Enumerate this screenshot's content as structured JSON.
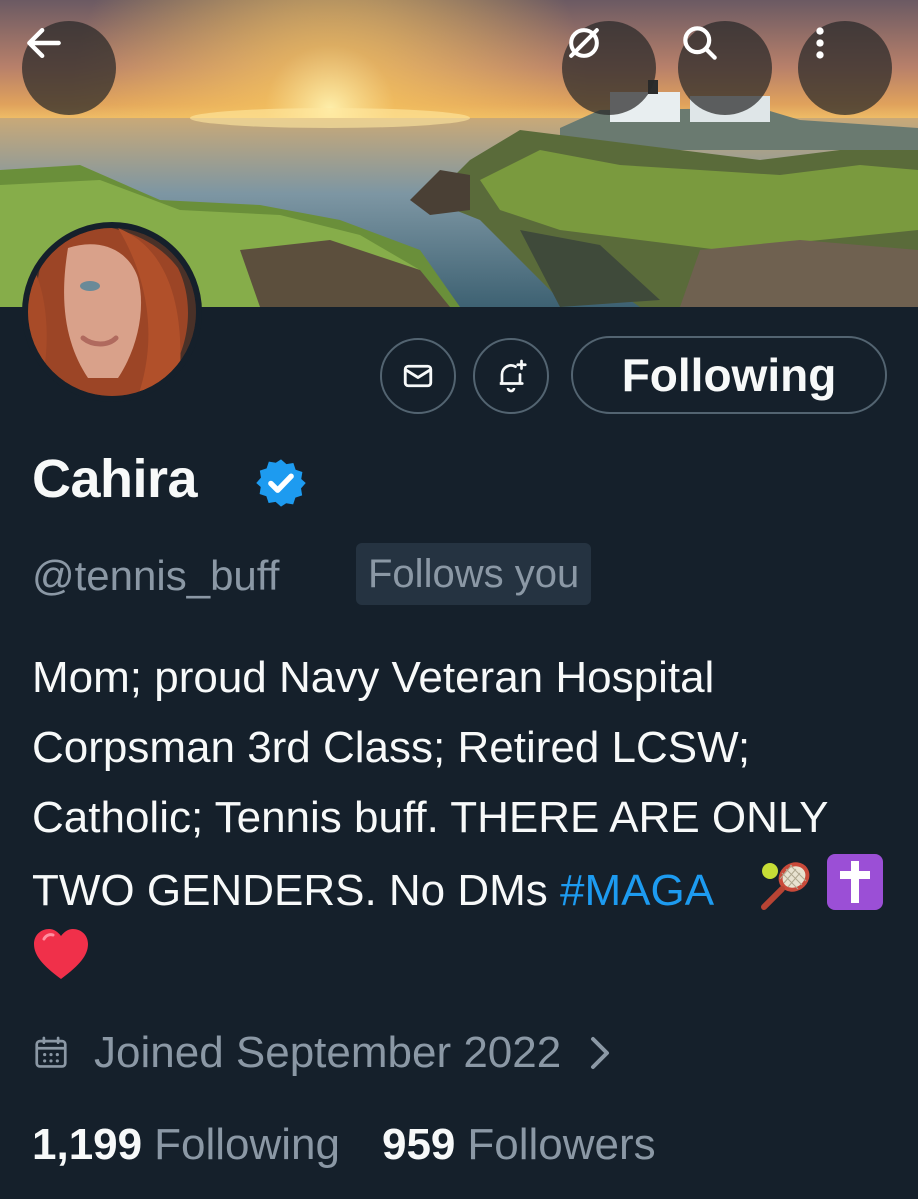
{
  "header": {
    "back_icon": "arrow-left-icon",
    "grok_icon": "slashed-circle-icon",
    "search_icon": "search-icon",
    "more_icon": "vertical-dots-icon"
  },
  "profile": {
    "display_name": "Cahira",
    "verified": true,
    "handle": "@tennis_buff",
    "follows_you_label": "Follows you",
    "bio_text": "Mom; proud Navy Veteran Hospital Corpsman 3rd Class;  Retired LCSW; Catholic; Tennis buff. THERE ARE ONLY TWO GENDERS. No DMs ",
    "bio_hashtag": "#MAGA",
    "bio_emojis": [
      "tennis-racket-emoji",
      "latin-cross-emoji",
      "red-heart-emoji"
    ],
    "joined": "Joined September 2022",
    "following_count": "1,199",
    "following_label": "Following",
    "followers_count": "959",
    "followers_label": "Followers"
  },
  "actions": {
    "message_icon": "envelope-icon",
    "notify_icon": "bell-plus-icon",
    "follow_button_label": "Following"
  },
  "colors": {
    "background": "#15202b",
    "accent": "#1d9bf0",
    "secondary_text": "#8b98a5",
    "border": "#536471"
  }
}
